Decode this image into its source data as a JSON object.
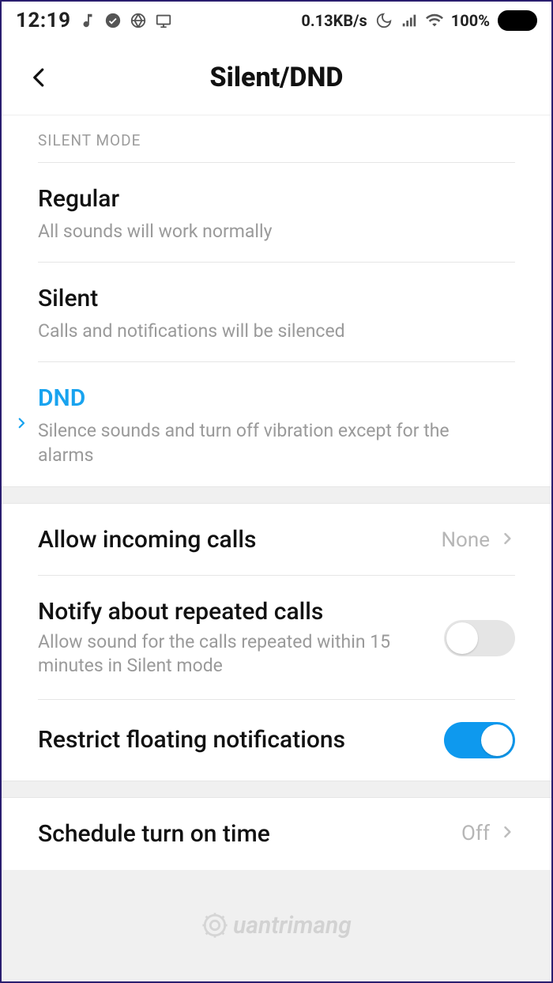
{
  "status": {
    "time": "12:19",
    "net_speed": "0.13KB/s",
    "battery": "100%"
  },
  "header": {
    "title": "Silent/DND"
  },
  "section_label": "SILENT MODE",
  "modes": [
    {
      "title": "Regular",
      "subtitle": "All sounds will work normally",
      "selected": false
    },
    {
      "title": "Silent",
      "subtitle": "Calls and notifications will be silenced",
      "selected": false
    },
    {
      "title": "DND",
      "subtitle": "Silence sounds and turn off vibration except for the alarms",
      "selected": true
    }
  ],
  "settings": {
    "allow_calls": {
      "label": "Allow incoming calls",
      "value": "None"
    },
    "repeated": {
      "label": "Notify about repeated calls",
      "subtitle": "Allow sound for the calls repeated within 15 minutes in Silent mode",
      "on": false
    },
    "restrict": {
      "label": "Restrict floating notifications",
      "on": true
    },
    "schedule": {
      "label": "Schedule turn on time",
      "value": "Off"
    }
  },
  "watermark": "uantrimang"
}
